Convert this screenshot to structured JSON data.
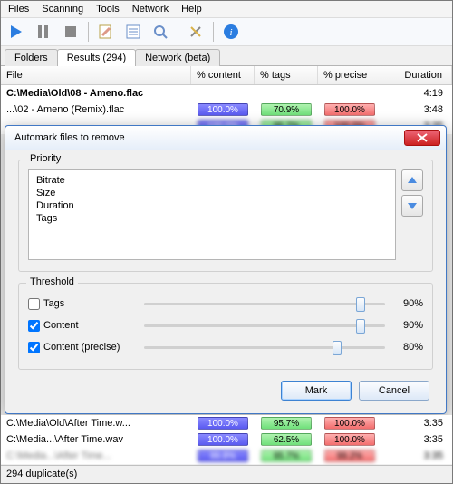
{
  "menu": {
    "files": "Files",
    "scanning": "Scanning",
    "tools": "Tools",
    "network": "Network",
    "help": "Help"
  },
  "tabs": {
    "folders": "Folders",
    "results": "Results (294)",
    "network": "Network (beta)"
  },
  "columns": {
    "file": "File",
    "content": "% content",
    "tags": "% tags",
    "precise": "% precise",
    "duration": "Duration"
  },
  "rows_top": [
    {
      "file": "C:\\Media\\Old\\08 - Ameno.flac",
      "bold": true,
      "content": "",
      "tags": "",
      "precise": "",
      "duration": "4:19"
    },
    {
      "file": "...\\02 - Ameno (Remix).flac",
      "content": "100.0%",
      "tags": "70.9%",
      "precise": "100.0%",
      "duration": "3:48"
    }
  ],
  "rows_bottom": [
    {
      "file": "C:\\Media\\Old\\After Time.w...",
      "content": "100.0%",
      "tags": "95.7%",
      "precise": "100.0%",
      "duration": "3:35"
    },
    {
      "file": "C:\\Media...\\After Time.wav",
      "content": "100.0%",
      "tags": "62.5%",
      "precise": "100.0%",
      "duration": "3:35"
    }
  ],
  "dialog": {
    "title": "Automark files to remove",
    "priority_label": "Priority",
    "priority_items": [
      "Bitrate",
      "Size",
      "Duration",
      "Tags"
    ],
    "threshold_label": "Threshold",
    "thresh_tags": {
      "label": "Tags",
      "checked": false,
      "value": "90%",
      "pos": 90
    },
    "thresh_content": {
      "label": "Content",
      "checked": true,
      "value": "90%",
      "pos": 90
    },
    "thresh_precise": {
      "label": "Content (precise)",
      "checked": true,
      "value": "80%",
      "pos": 80
    },
    "mark": "Mark",
    "cancel": "Cancel"
  },
  "status": "294 duplicate(s)"
}
